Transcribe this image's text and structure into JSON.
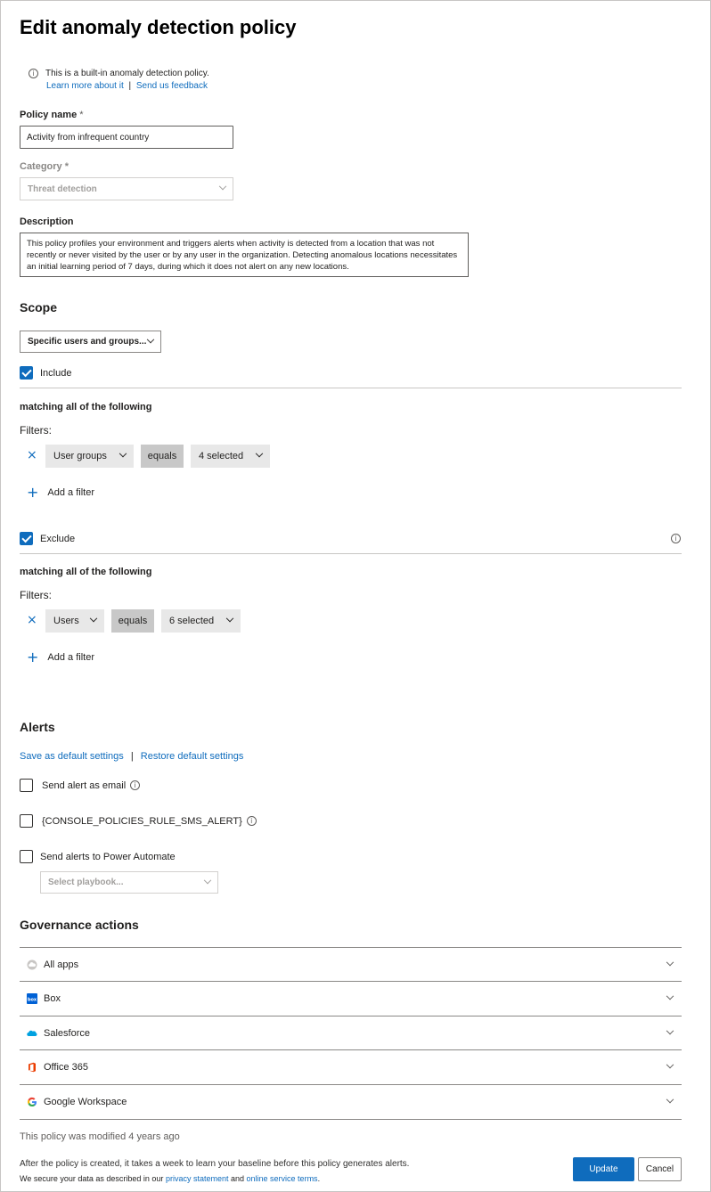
{
  "page": {
    "title": "Edit anomaly detection policy"
  },
  "notice": {
    "text": "This is a built-in anomaly detection policy.",
    "learn_more": "Learn more about it",
    "separator": "|",
    "feedback": "Send us feedback"
  },
  "policy_name": {
    "label": "Policy name",
    "required_mark": "*",
    "value": "Activity from infrequent country"
  },
  "category": {
    "label": "Category",
    "required_mark": "*",
    "value": "Threat detection"
  },
  "description": {
    "label": "Description",
    "value": "This policy profiles your environment and triggers alerts when activity is detected from a location that was not recently or never visited by the user or by any user in the organization. Detecting anomalous locations necessitates an initial learning period of 7 days, during which it does not alert on any new locations."
  },
  "scope": {
    "heading": "Scope",
    "dropdown_value": "Specific users and groups...",
    "include": {
      "label": "Include",
      "checked": true,
      "matching": "matching all of the following",
      "filters_label": "Filters:",
      "filter": {
        "field": "User groups",
        "operator": "equals",
        "value": "4 selected"
      },
      "add_filter": "Add a filter"
    },
    "exclude": {
      "label": "Exclude",
      "checked": true,
      "matching": "matching all of the following",
      "filters_label": "Filters:",
      "filter": {
        "field": "Users",
        "operator": "equals",
        "value": "6 selected"
      },
      "add_filter": "Add a filter"
    }
  },
  "alerts": {
    "heading": "Alerts",
    "save_default": "Save as default settings",
    "separator": "|",
    "restore_default": "Restore default settings",
    "email": {
      "label": "Send alert as email",
      "checked": false
    },
    "sms": {
      "label": "{CONSOLE_POLICIES_RULE_SMS_ALERT}",
      "checked": false
    },
    "power_automate": {
      "label": "Send alerts to Power Automate",
      "checked": false
    },
    "playbook_placeholder": "Select playbook..."
  },
  "governance": {
    "heading": "Governance actions",
    "rows": [
      {
        "label": "All apps",
        "icon": "cloud-icon"
      },
      {
        "label": "Box",
        "icon": "box-icon"
      },
      {
        "label": "Salesforce",
        "icon": "salesforce-icon"
      },
      {
        "label": "Office 365",
        "icon": "office-icon"
      },
      {
        "label": "Google Workspace",
        "icon": "google-icon"
      }
    ]
  },
  "footer": {
    "modified": "This policy was modified 4 years ago",
    "baseline_note": "After the policy is created, it takes a week to learn your baseline before this policy generates alerts.",
    "privacy_prefix": "We secure your data as described in our",
    "privacy_link": "privacy statement",
    "privacy_and": "and",
    "terms_link": "online service terms",
    "privacy_suffix": ".",
    "update_label": "Update",
    "cancel_label": "Cancel"
  },
  "colors": {
    "accent": "#0f6cbd",
    "border": "#8a8886",
    "pill": "#e8e8e8",
    "operator_pill": "#c8c8c8"
  }
}
